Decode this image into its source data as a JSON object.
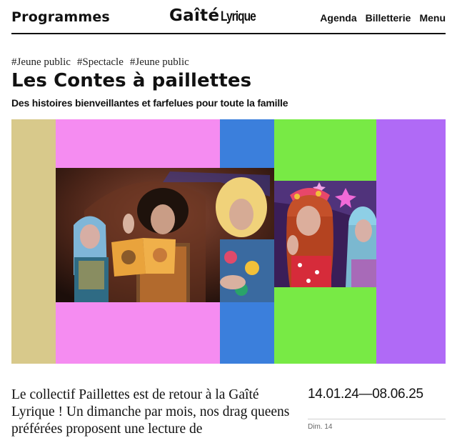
{
  "header": {
    "programmes_label": "Programmes",
    "logo_main": "Gaîté",
    "logo_sub": "Lyrique",
    "nav": [
      "Agenda",
      "Billetterie",
      "Menu"
    ]
  },
  "event": {
    "tags": [
      "#Jeune public",
      "#Spectacle",
      "#Jeune public"
    ],
    "title": "Les Contes à paillettes",
    "subtitle": "Des histoires bienveillantes et farfelues pour toute la famille",
    "description": "Le collectif Paillettes est de retour à la Gaîté Lyrique ! Un dimanche par mois, nos drag queens préférées proposent une lecture de",
    "dates": "14.01.24—08.06.25",
    "next_item": "Dim. 14"
  },
  "colors": {
    "tan": "#d8c98b",
    "pink": "#f58cf1",
    "blue": "#3b7fdc",
    "green": "#78ea45",
    "purple": "#b06af6"
  },
  "images": {
    "photo_left": "drag queens reading a picture book on stage",
    "photo_right": "drag queen gesturing with raised hand"
  }
}
